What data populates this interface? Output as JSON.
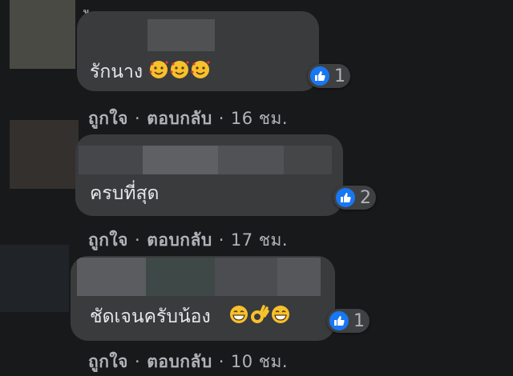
{
  "top_fragment": "ู",
  "comments": [
    {
      "text": "รักนาง",
      "emojis": [
        "smiling-face-with-hearts-emoji",
        "smiling-face-with-hearts-emoji",
        "smiling-face-with-hearts-emoji"
      ],
      "reaction_count": "1",
      "like_label": "ถูกใจ",
      "reply_label": "ตอบกลับ",
      "separator": "·",
      "time": "16 ชม."
    },
    {
      "text": "ครบที่สุด",
      "emojis": [],
      "reaction_count": "2",
      "like_label": "ถูกใจ",
      "reply_label": "ตอบกลับ",
      "separator": "·",
      "time": "17 ชม."
    },
    {
      "text": "ชัดเจนครับน้อง",
      "emojis": [
        "grinning-face-emoji",
        "ok-hand-emoji",
        "grinning-face-emoji"
      ],
      "reaction_count": "1",
      "like_label": "ถูกใจ",
      "reply_label": "ตอบกลับ",
      "separator": "·",
      "time": "10 ชม."
    }
  ],
  "colors": {
    "background": "#18191a",
    "bubble": "#3a3b3c",
    "text": "#e4e6eb",
    "secondary_text": "#b0b3b8",
    "like_blue": "#1877f2"
  }
}
